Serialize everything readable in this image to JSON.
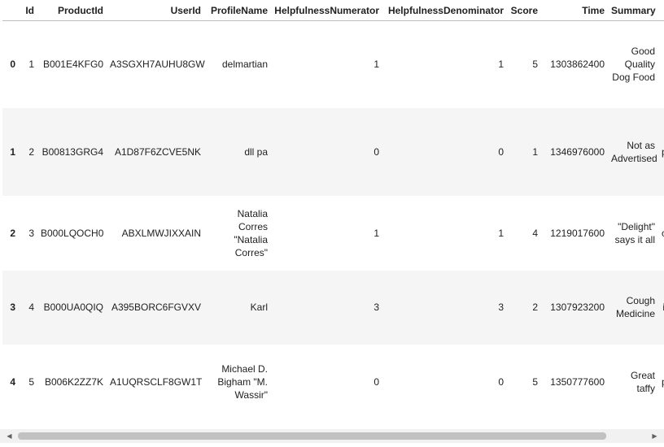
{
  "table": {
    "columns": [
      "",
      "Id",
      "ProductId",
      "UserId",
      "ProfileName",
      "HelpfulnessNumerator",
      "HelpfulnessDenominator",
      "Score",
      "Time",
      "Summary",
      ""
    ],
    "rows": [
      {
        "index": "0",
        "Id": "1",
        "ProductId": "B001E4KFG0",
        "UserId": "A3SGXH7AUHU8GW",
        "ProfileName": "delmartian",
        "HelpfulnessNumerator": "1",
        "HelpfulnessDenominator": "1",
        "Score": "5",
        "Time": "1303862400",
        "Summary": "Good Quality Dog Food",
        "Text": ""
      },
      {
        "index": "1",
        "Id": "2",
        "ProductId": "B00813GRG4",
        "UserId": "A1D87F6ZCVE5NK",
        "ProfileName": "dll pa",
        "HelpfulnessNumerator": "0",
        "HelpfulnessDenominator": "0",
        "Score": "1",
        "Time": "1346976000",
        "Summary": "Not as Advertised",
        "Text": "p"
      },
      {
        "index": "2",
        "Id": "3",
        "ProductId": "B000LQOCH0",
        "UserId": "ABXLMWJIXXAIN",
        "ProfileName": "Natalia Corres \"Natalia Corres\"",
        "HelpfulnessNumerator": "1",
        "HelpfulnessDenominator": "1",
        "Score": "4",
        "Time": "1219017600",
        "Summary": "\"Delight\" says it all",
        "Text": "c"
      },
      {
        "index": "3",
        "Id": "4",
        "ProductId": "B000UA0QIQ",
        "UserId": "A395BORC6FGVXV",
        "ProfileName": "Karl",
        "HelpfulnessNumerator": "3",
        "HelpfulnessDenominator": "3",
        "Score": "2",
        "Time": "1307923200",
        "Summary": "Cough Medicine",
        "Text": "i"
      },
      {
        "index": "4",
        "Id": "5",
        "ProductId": "B006K2ZZ7K",
        "UserId": "A1UQRSCLF8GW1T",
        "ProfileName": "Michael D. Bigham \"M. Wassir\"",
        "HelpfulnessNumerator": "0",
        "HelpfulnessDenominator": "0",
        "Score": "5",
        "Time": "1350777600",
        "Summary": "Great taffy",
        "Text": "p"
      }
    ]
  },
  "scrollbar": {
    "left_arrow_icon": "triangle-left-icon",
    "right_arrow_icon": "triangle-right-icon",
    "left_glyph": "◀",
    "right_glyph": "▶"
  }
}
